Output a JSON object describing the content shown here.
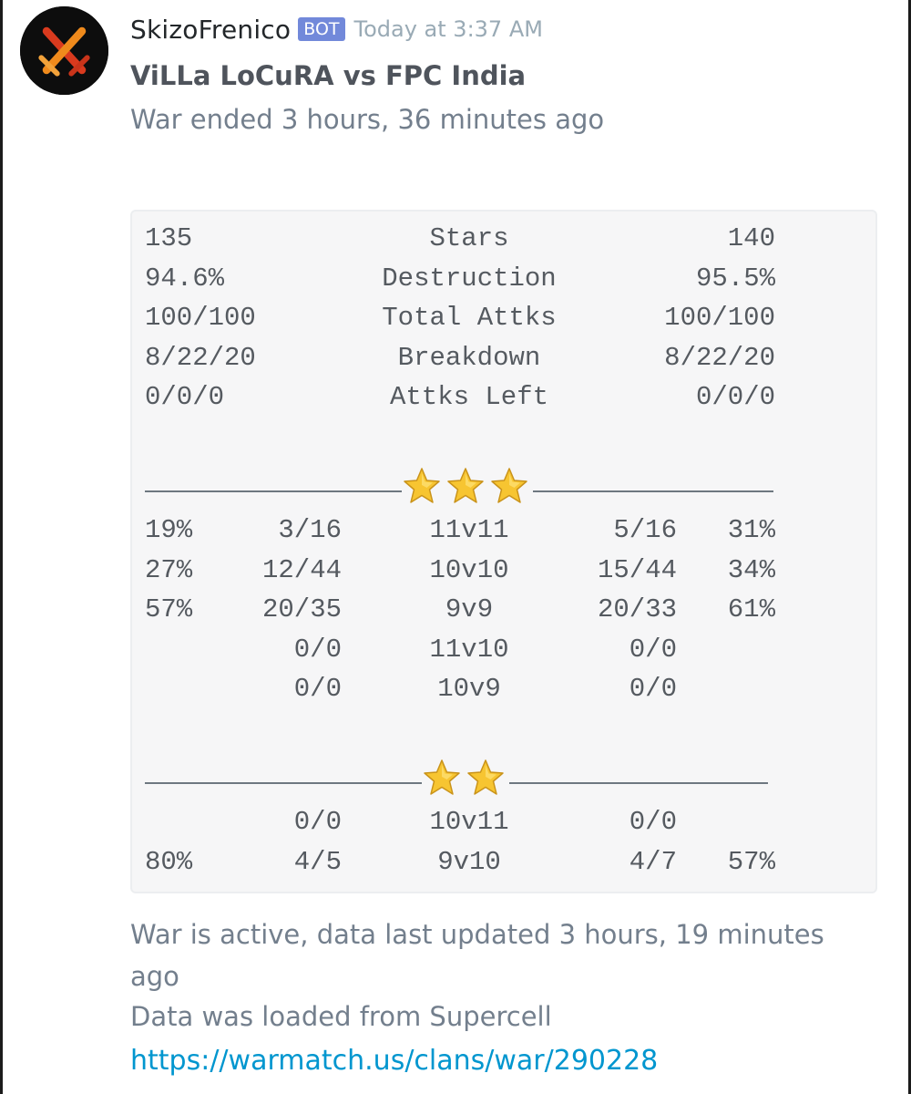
{
  "message": {
    "username": "SkizoFrenico",
    "bot_tag": "BOT",
    "timestamp": "Today at 3:37 AM",
    "avatar_icon": "crossed-swords-icon"
  },
  "embed": {
    "title": "ViLLa LoCuRA vs FPC India",
    "subtitle": "War ended 3 hours, 36 minutes ago",
    "summary": [
      {
        "left": "135",
        "label": "Stars",
        "right": "140"
      },
      {
        "left": "94.6%",
        "label": "Destruction",
        "right": "95.5%"
      },
      {
        "left": "100/100",
        "label": "Total Attks",
        "right": "100/100"
      },
      {
        "left": "8/22/20",
        "label": "Breakdown",
        "right": "8/22/20"
      },
      {
        "left": "0/0/0",
        "label": "Attks Left",
        "right": "0/0/0"
      }
    ],
    "three_star_section": {
      "star_count": 3,
      "star_icon": "star-icon",
      "rows": [
        {
          "lpct": "19%",
          "lfrac": "3/16",
          "matchup": "11v11",
          "rfrac": "5/16",
          "rpct": "31%"
        },
        {
          "lpct": "27%",
          "lfrac": "12/44",
          "matchup": "10v10",
          "rfrac": "15/44",
          "rpct": "34%"
        },
        {
          "lpct": "57%",
          "lfrac": "20/35",
          "matchup": "9v9",
          "rfrac": "20/33",
          "rpct": "61%"
        },
        {
          "lpct": "",
          "lfrac": "0/0",
          "matchup": "11v10",
          "rfrac": "0/0",
          "rpct": ""
        },
        {
          "lpct": "",
          "lfrac": "0/0",
          "matchup": "10v9",
          "rfrac": "0/0",
          "rpct": ""
        }
      ]
    },
    "two_star_section": {
      "star_count": 2,
      "star_icon": "star-icon",
      "rows": [
        {
          "lpct": "",
          "lfrac": "0/0",
          "matchup": "10v11",
          "rfrac": "0/0",
          "rpct": ""
        },
        {
          "lpct": "80%",
          "lfrac": "4/5",
          "matchup": "9v10",
          "rfrac": "4/7",
          "rpct": "57%"
        }
      ]
    },
    "footer_line1": "War is active, data last updated 3 hours, 19 minutes",
    "footer_line2": "ago",
    "footer_line3": "Data was loaded from Supercell",
    "link": "https://warmatch.us/clans/war/290228"
  },
  "colors": {
    "bot_tag": "#7289da",
    "link": "#0096cf",
    "code_bg": "#f6f6f7",
    "star": "#f7c531"
  }
}
